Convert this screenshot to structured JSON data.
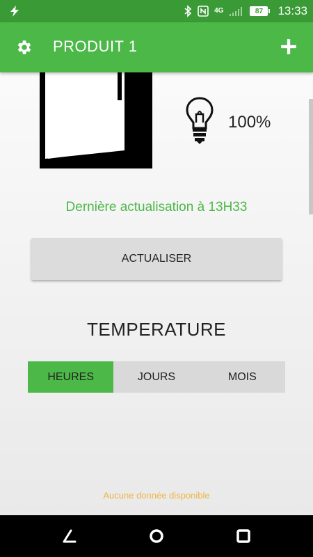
{
  "status_bar": {
    "time": "13:33",
    "network": "4G",
    "battery": "87",
    "icons": [
      "flash-icon",
      "bluetooth-icon",
      "nfc-icon",
      "signal-icon",
      "battery-icon"
    ]
  },
  "toolbar": {
    "title": "PRODUIT 1",
    "settings_icon": "gear-icon",
    "add_icon": "plus-icon"
  },
  "product": {
    "intensity": "100%",
    "last_update": "Dernière actualisation à 13H33",
    "refresh_label": "ACTUALISER"
  },
  "temperature": {
    "title": "TEMPERATURE",
    "tabs": [
      {
        "label": "HEURES",
        "active": true
      },
      {
        "label": "JOURS",
        "active": false
      },
      {
        "label": "MOIS",
        "active": false
      }
    ],
    "empty_message": "Aucune donnée disponible"
  },
  "colors": {
    "status_bar": "#3a9a35",
    "accent": "#4cb848",
    "empty_message": "#f0b445"
  },
  "nav_bar": {
    "buttons": [
      "back-icon",
      "home-icon",
      "recents-icon"
    ]
  }
}
